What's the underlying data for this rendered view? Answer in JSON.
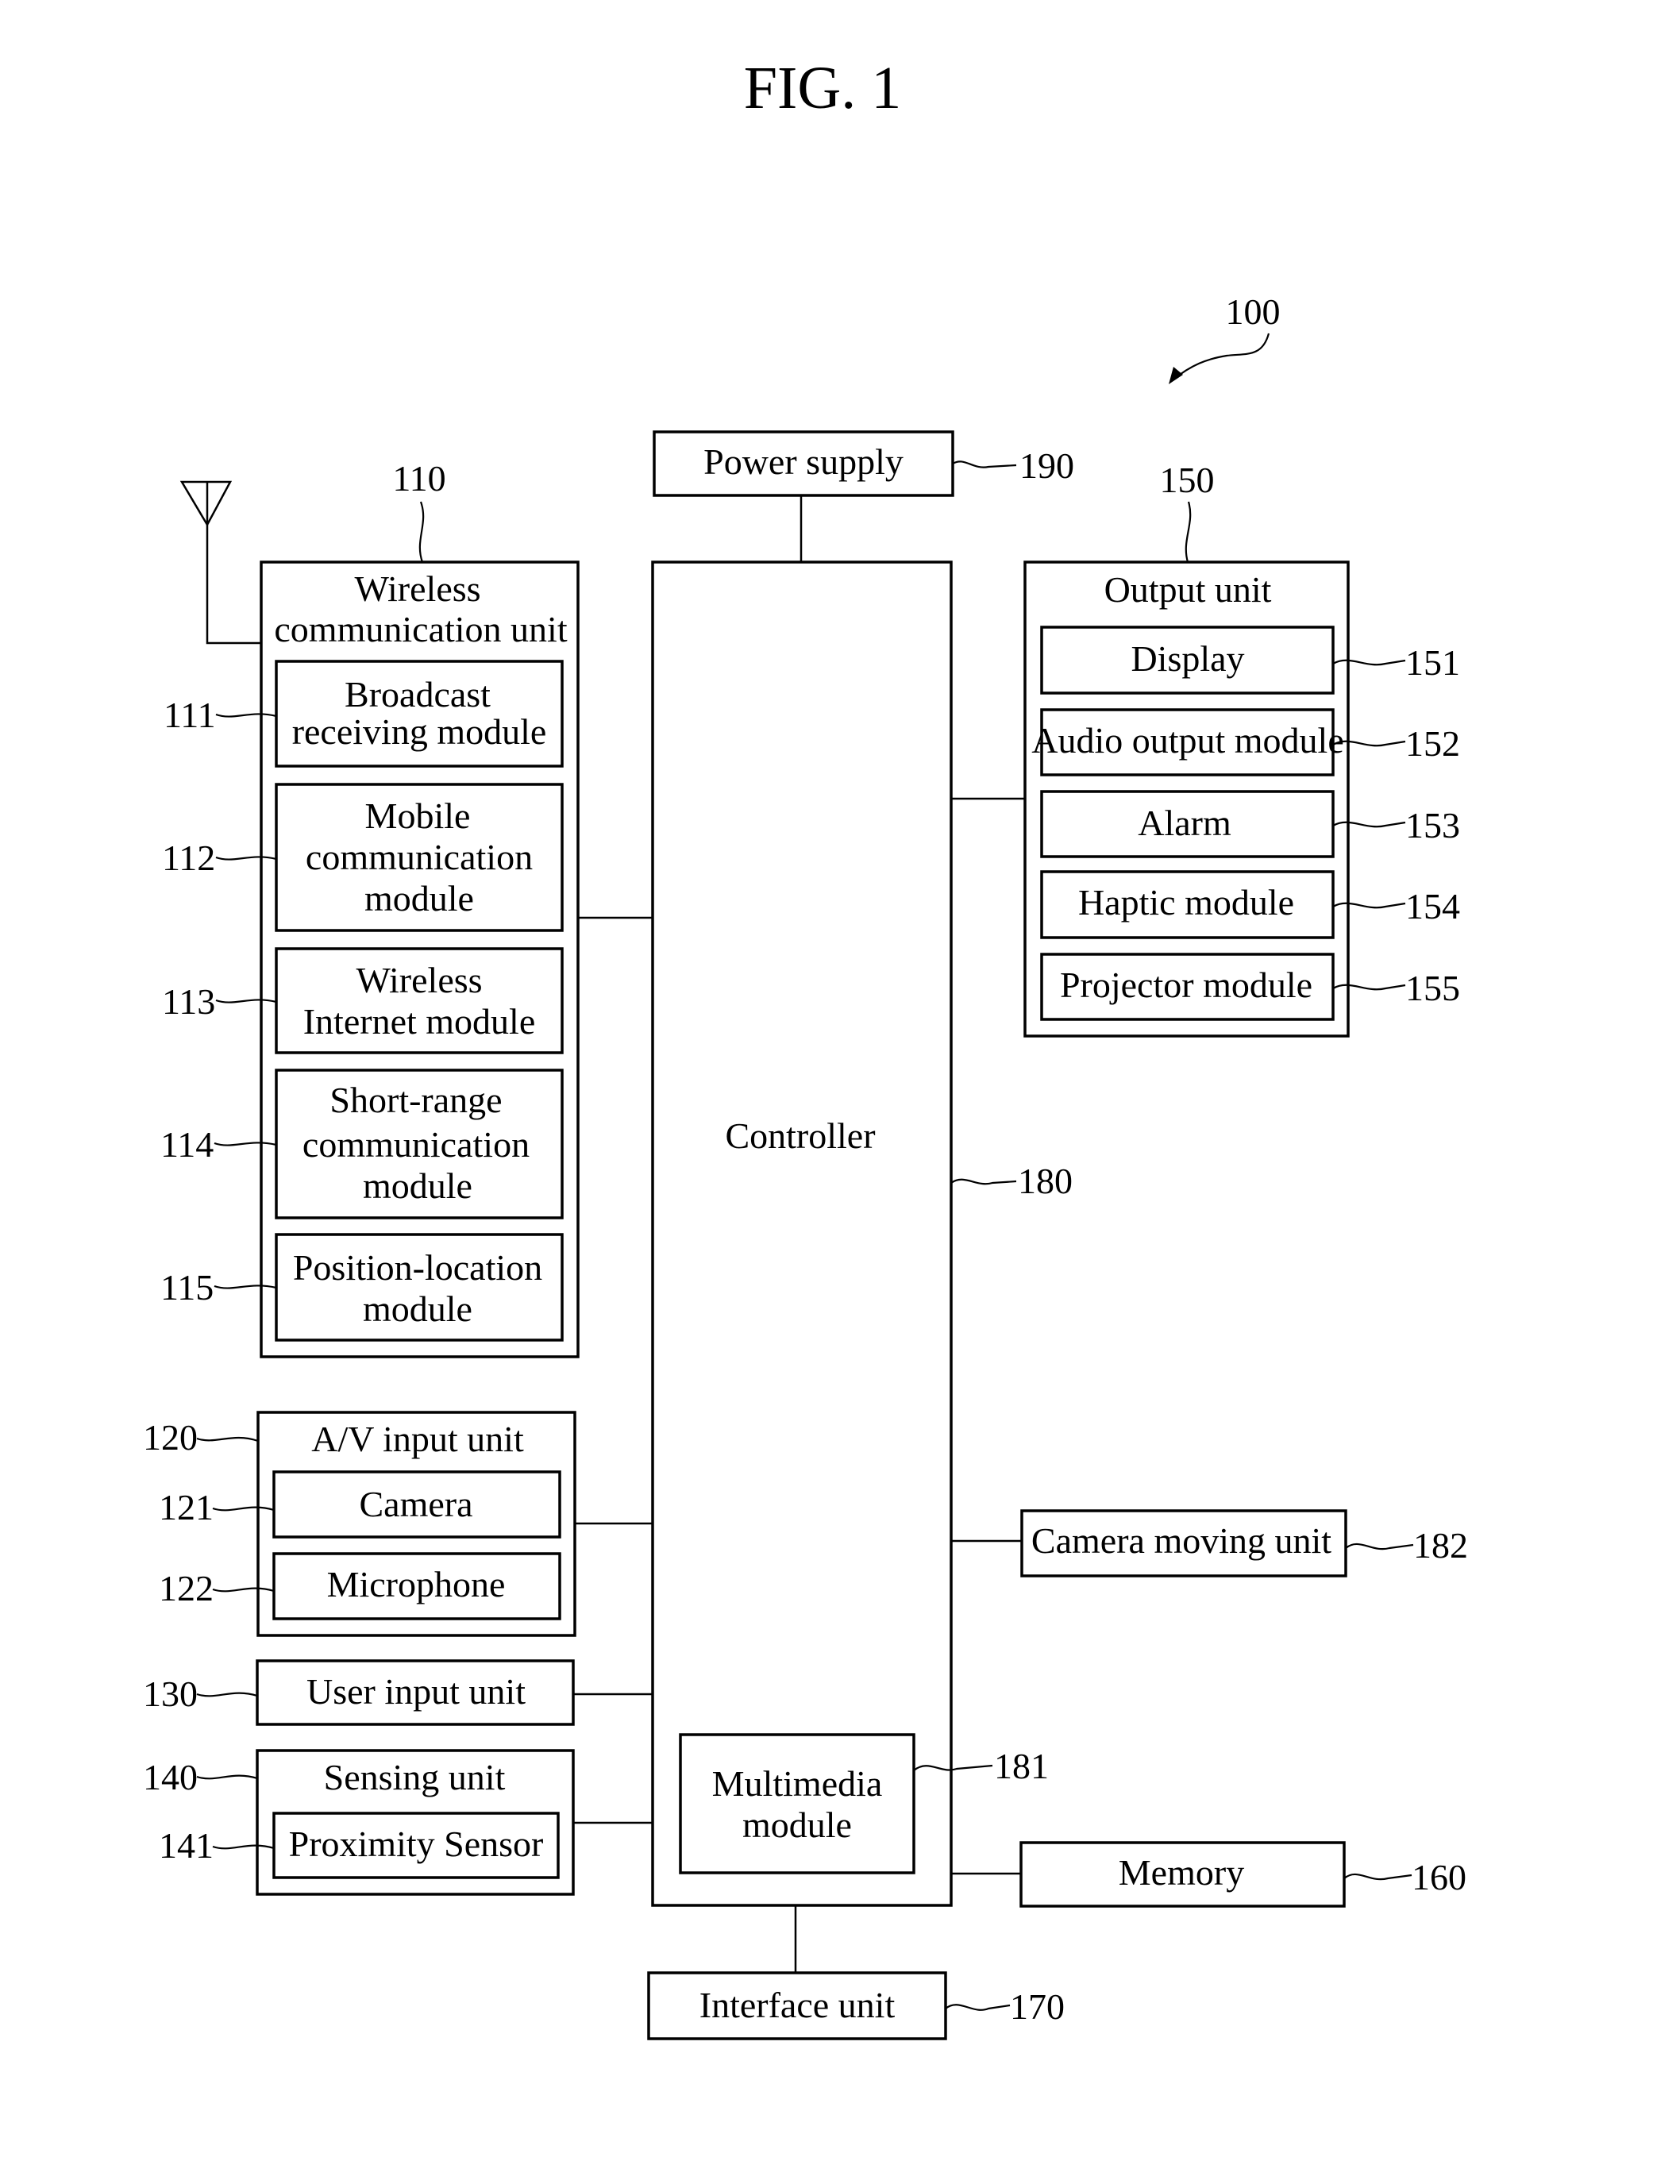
{
  "figure": {
    "title": "FIG. 1",
    "device_ref": "100"
  },
  "blocks": {
    "power_supply": {
      "label": "Power supply",
      "ref": "190"
    },
    "controller": {
      "label": "Controller",
      "ref": "180"
    },
    "multimedia_module": {
      "lines": [
        "Multimedia",
        "module"
      ],
      "ref": "181"
    },
    "interface_unit": {
      "label": "Interface unit",
      "ref": "170"
    },
    "memory": {
      "label": "Memory",
      "ref": "160"
    },
    "camera_moving_unit": {
      "label": "Camera moving unit",
      "ref": "182"
    },
    "output_unit": {
      "label": "Output unit",
      "ref": "150",
      "items": [
        {
          "label": "Display",
          "ref": "151"
        },
        {
          "label": "Audio output module",
          "ref": "152"
        },
        {
          "label": "Alarm",
          "ref": "153"
        },
        {
          "label": "Haptic module",
          "ref": "154"
        },
        {
          "label": "Projector module",
          "ref": "155"
        }
      ]
    },
    "wireless_unit": {
      "lines": [
        "Wireless",
        "communication unit"
      ],
      "ref": "110",
      "items": [
        {
          "lines": [
            "Broadcast",
            "receiving module"
          ],
          "ref": "111"
        },
        {
          "lines": [
            "Mobile",
            "communication",
            "module"
          ],
          "ref": "112"
        },
        {
          "lines": [
            "Wireless",
            "Internet module"
          ],
          "ref": "113"
        },
        {
          "lines": [
            "Short-range",
            "communication",
            "module"
          ],
          "ref": "114"
        },
        {
          "lines": [
            "Position-location",
            "module"
          ],
          "ref": "115"
        }
      ]
    },
    "av_input_unit": {
      "label": "A/V input unit",
      "ref": "120",
      "items": [
        {
          "label": "Camera",
          "ref": "121"
        },
        {
          "label": "Microphone",
          "ref": "122"
        }
      ]
    },
    "user_input_unit": {
      "label": "User input unit",
      "ref": "130"
    },
    "sensing_unit": {
      "label": "Sensing unit",
      "ref": "140",
      "items": [
        {
          "label": "Proximity Sensor",
          "ref": "141"
        }
      ]
    }
  }
}
